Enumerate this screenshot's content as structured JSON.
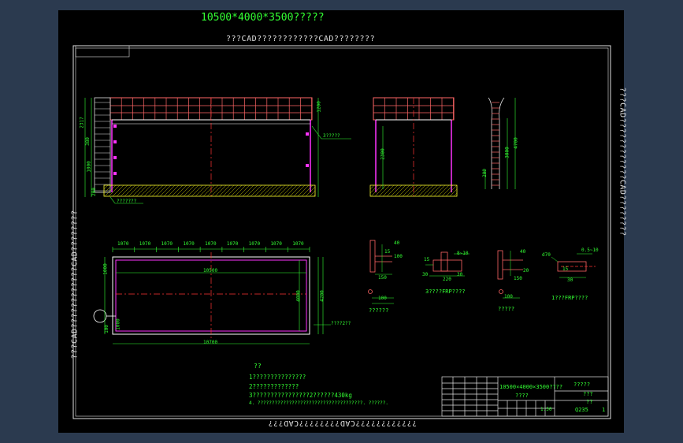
{
  "title": "10500*4000*3500?????",
  "watermark_top": "???CAD????????????CAD????????",
  "watermark_bottom": "????????????CAD????????CAD???",
  "watermark_left": "???CAD????????????CAD????????",
  "watermark_right": "???CAD????????????CAD????????",
  "front_view": {
    "dim_top": "?????",
    "dim_height_upper": "1200",
    "dim_height_total": "3500",
    "dim_left_1": "2317",
    "dim_left_2": "380",
    "dim_left_3": "1000",
    "dim_left_4": "200",
    "callout_right": "3?????",
    "callout_left": "???????"
  },
  "side_view": {
    "dim_height": "2300"
  },
  "ladder_view": {
    "dim_height": "4700",
    "dim_span": "3000",
    "dim_base": "200"
  },
  "plan_view": {
    "top_dims": [
      "1070",
      "1070",
      "1070",
      "1070",
      "1070",
      "1070",
      "1070",
      "1070",
      "1070"
    ],
    "dim_inner": "10500",
    "dim_outer": "10700",
    "dim_right_inner": "4000",
    "dim_right_outer": "4200",
    "dim_left_1": "1000",
    "dim_left_2": "1000",
    "dim_left_3": "100",
    "callout": "????2??"
  },
  "details": {
    "d1_label": "??????",
    "d1_dims": [
      "40",
      "15",
      "100",
      "150",
      "100"
    ],
    "d2_label": "3????FRP????",
    "d2_dims": [
      "15",
      "8~10",
      "30",
      "220",
      "30"
    ],
    "d3_label": "?????",
    "d3_dims": [
      "40",
      "20",
      "150",
      "100"
    ],
    "d4_label": "1???FRP????",
    "d4_dims": [
      "d70",
      "0.5~10",
      "15",
      "30"
    ]
  },
  "notes": {
    "heading": "??",
    "lines": [
      "1???????????????",
      "2?????????????",
      "3????????????????2??????430kg",
      "4. ?????????????????????????????????????.     ??????."
    ]
  },
  "title_block": {
    "drawing_name": "10500×4000×3500????",
    "drawing_sub": "????",
    "company": "?????",
    "drawn": "???",
    "checked": "??",
    "scale": "1:50",
    "material": "Q235",
    "sheet": "1"
  }
}
